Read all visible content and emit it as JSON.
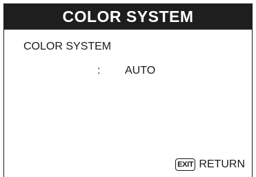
{
  "window": {
    "title": "COLOR SYSTEM"
  },
  "setting": {
    "label": "COLOR SYSTEM",
    "separator": ":",
    "value": "AUTO"
  },
  "footer": {
    "key_label": "EXIT",
    "action_label": "RETURN"
  }
}
